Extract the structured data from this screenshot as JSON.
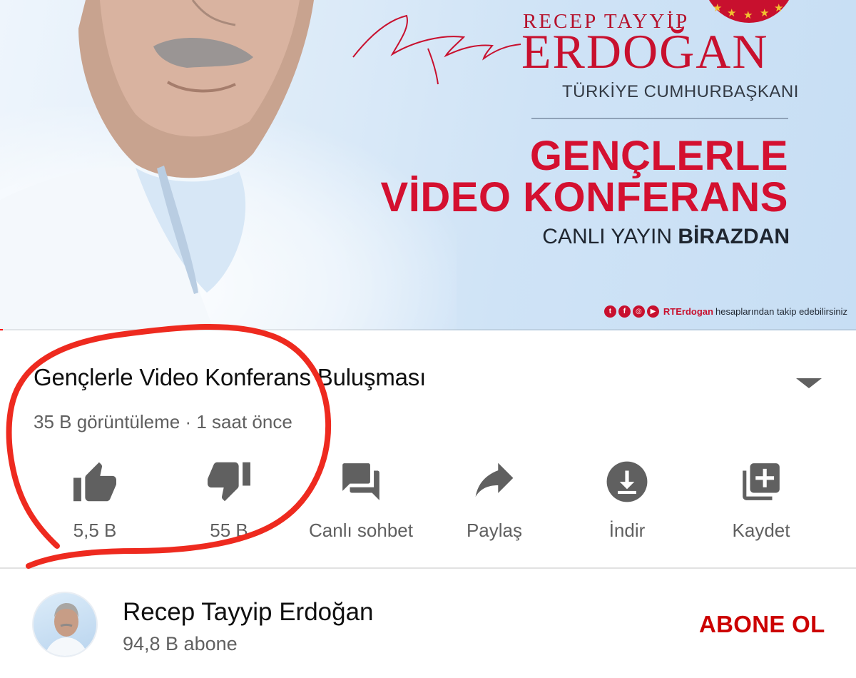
{
  "thumbnail": {
    "name_line1": "RECEP TAYYİP",
    "name_line2": "ERDOĞAN",
    "office": "TÜRKİYE CUMHURBAŞKANI",
    "headline_line1": "GENÇLERLE",
    "headline_line2": "VİDEO KONFERANS",
    "live_prefix": "CANLI YAYIN",
    "live_emphasis": "BİRAZDAN",
    "social_handle": "RTErdogan",
    "social_text": "hesaplarından takip edebilirsiniz",
    "social_icons": [
      "twitter-icon",
      "facebook-icon",
      "instagram-icon",
      "youtube-icon"
    ],
    "brand_red": "#c8102e",
    "playback_progress": 0.003
  },
  "video": {
    "title": "Gençlerle Video Konferans Buluşması",
    "meta": "35 B görüntüleme · 1 saat önce"
  },
  "actions": [
    {
      "icon": "thumbs-up-icon",
      "label": "5,5 B"
    },
    {
      "icon": "thumbs-down-icon",
      "label": "55 B"
    },
    {
      "icon": "live-chat-icon",
      "label": "Canlı sohbet"
    },
    {
      "icon": "share-icon",
      "label": "Paylaş"
    },
    {
      "icon": "download-icon",
      "label": "İndir"
    },
    {
      "icon": "save-playlist-icon",
      "label": "Kaydet"
    }
  ],
  "channel": {
    "name": "Recep Tayyip Erdoğan",
    "subscribers": "94,8 B abone",
    "subscribe_label": "ABONE OL"
  },
  "colors": {
    "icon_gray": "#606060",
    "subscribe_red": "#cc0000",
    "annotation_red": "#ee2a1f"
  }
}
